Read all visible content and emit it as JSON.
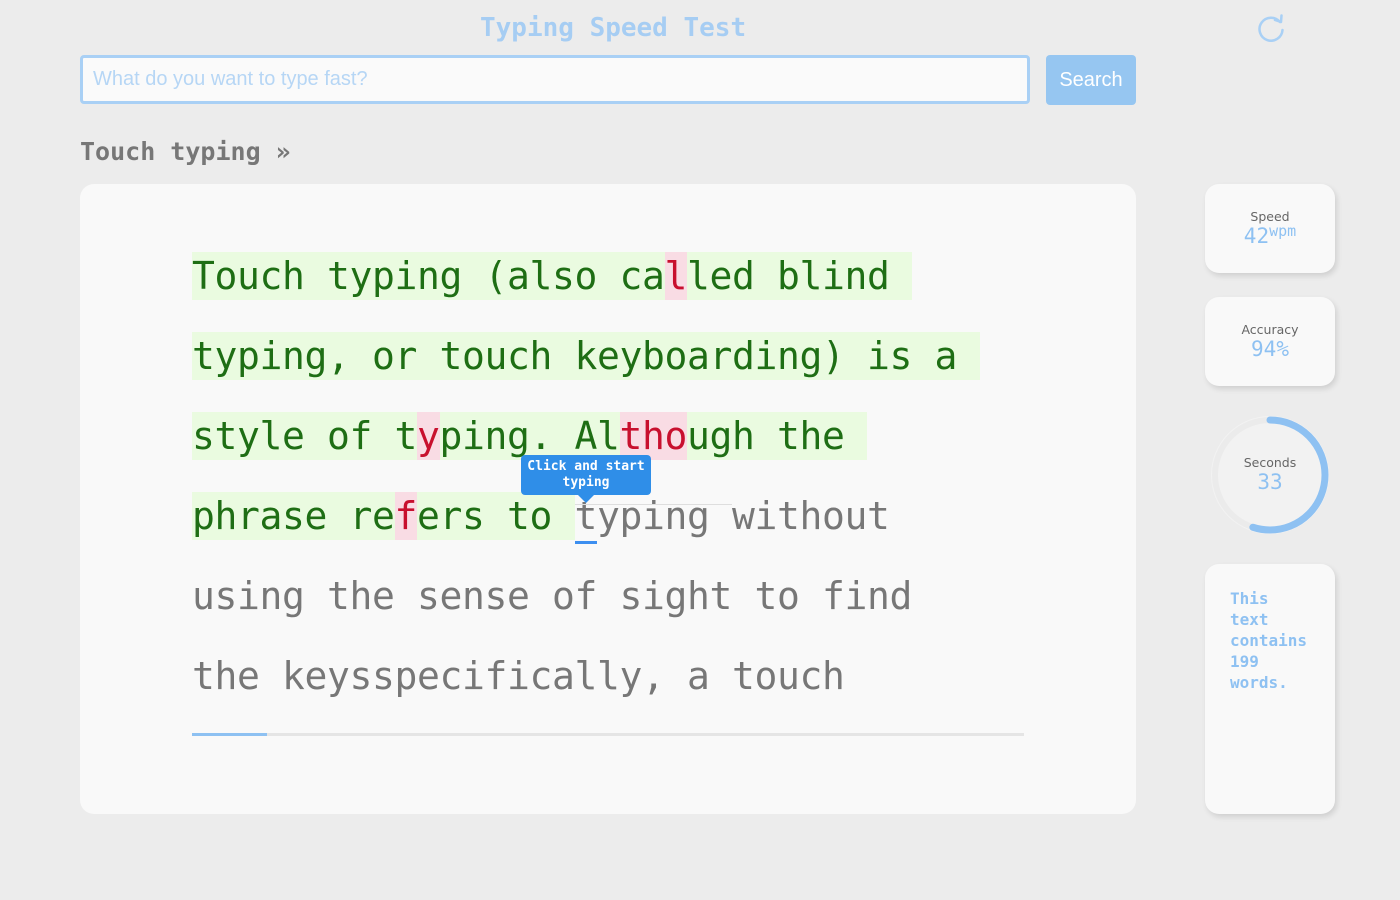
{
  "app": {
    "title": "Typing Speed Test",
    "reload_icon": "reload-icon"
  },
  "search": {
    "placeholder": "What do you want to type fast?",
    "value": "",
    "button_label": "Search"
  },
  "breadcrumb": {
    "label": "Touch typing »"
  },
  "passage": {
    "lines": [
      "Touch typing (also called blind ",
      "typing, or touch keyboarding) is a ",
      "style of typing. Although the ",
      "phrase refers to typing without ",
      "using the sense of sight to find ",
      "the keysspecifically, a touch "
    ],
    "typed_count": {
      "line": 3,
      "column": 17
    },
    "errors": [
      {
        "line": 0,
        "column": 21
      },
      {
        "line": 2,
        "column": 10
      },
      {
        "line": 2,
        "column": 19
      },
      {
        "line": 2,
        "column": 20
      },
      {
        "line": 2,
        "column": 21
      }
    ],
    "errors_line_3": [
      9
    ],
    "tooltip": "Click and start typing",
    "progress_fraction": 0.09
  },
  "stats": {
    "speed_label": "Speed",
    "speed_value": "42",
    "speed_unit": "wpm",
    "accuracy_label": "Accuracy",
    "accuracy_value": "94%",
    "seconds_label": "Seconds",
    "seconds_value": "33",
    "seconds_fraction": 0.55
  },
  "info": {
    "text": "This text contains 199 words."
  },
  "colors": {
    "accent": "#8ec1f2",
    "correct_bg": "#eafbe0",
    "correct_text": "#1e6e14",
    "error_bg": "#f9dce4",
    "error_text": "#c8102e",
    "pending_text": "#777777"
  }
}
